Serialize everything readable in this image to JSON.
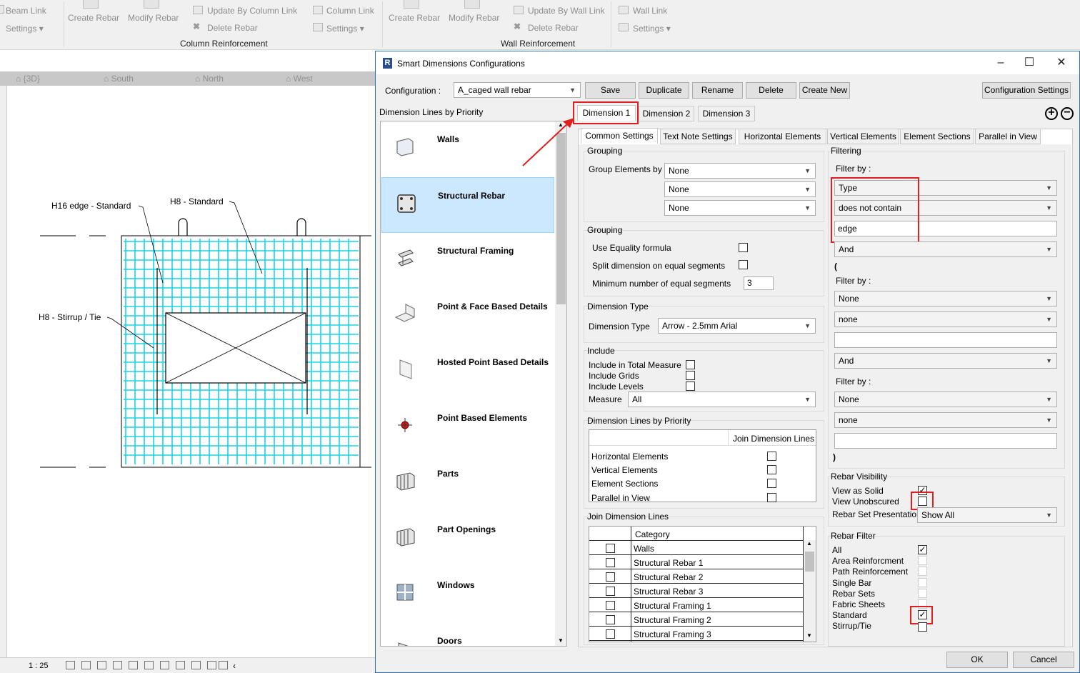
{
  "ribbon": {
    "beam_link": "Beam Link",
    "settings1": "Settings",
    "create_rebar1": "Create Rebar",
    "modify_rebar1": "Modify Rebar",
    "update_by_column_link": "Update By Column Link",
    "delete_rebar1": "Delete Rebar",
    "column_link": "Column Link",
    "settings2": "Settings",
    "column_group": "Column Reinforcement",
    "create_rebar2": "Create Rebar",
    "modify_rebar2": "Modify Rebar",
    "update_by_wall_link": "Update By Wall Link",
    "delete_rebar2": "Delete Rebar",
    "wall_link": "Wall Link",
    "settings3": "Settings",
    "wall_group": "Wall Reinforcement"
  },
  "view_tabs": [
    "{3D}",
    "South",
    "North",
    "West"
  ],
  "drawing": {
    "tag1": "H16 edge -  Standard",
    "tag2": "H8 -  Standard",
    "tag3": "H8 -  Stirrup / Tie",
    "scale": "1 : 25"
  },
  "dialog": {
    "title": "Smart Dimensions Configurations",
    "configuration_label": "Configuration :",
    "configuration_value": "A_caged wall rebar",
    "buttons": [
      "Save",
      "Duplicate",
      "Rename",
      "Delete",
      "Create New"
    ],
    "config_settings": "Configuration Settings",
    "priority_title": "Dimension Lines by Priority",
    "priority_items": [
      "Walls",
      "Structural Rebar",
      "Structural Framing",
      "Point & Face Based Details",
      "Hosted Point Based Details",
      "Point Based Elements",
      "Parts",
      "Part Openings",
      "Windows",
      "Doors"
    ],
    "dim_tabs": [
      "Dimension 1",
      "Dimension 2",
      "Dimension 3"
    ],
    "sub_tabs": [
      "Common Settings",
      "Text Note Settings",
      "Horizontal Elements",
      "Vertical Elements",
      "Element Sections",
      "Parallel in View"
    ],
    "grouping_title": "Grouping",
    "group_by_label": "Group Elements by",
    "group_values": [
      "None",
      "None",
      "None"
    ],
    "grouping2_title": "Grouping",
    "use_equality": "Use Equality formula",
    "split_dimension": "Split dimension on equal segments",
    "min_segments": "Minimum number of equal segments",
    "min_segments_value": "3",
    "dimtype_title": "Dimension Type",
    "dimtype_label": "Dimension Type",
    "dimtype_value": "Arrow - 2.5mm Arial",
    "include_title": "Include",
    "include_total": "Include in Total Measure",
    "include_grids": "Include Grids",
    "include_levels": "Include Levels",
    "measure_label": "Measure",
    "measure_value": "All",
    "dlp_title": "Dimension Lines by Priority",
    "dlp_header": "Join Dimension Lines",
    "dlp_rows": [
      "Horizontal Elements",
      "Vertical Elements",
      "Element Sections",
      "Parallel in View"
    ],
    "join_title": "Join Dimension Lines",
    "join_header": "Category",
    "join_rows": [
      "Walls",
      "Structural Rebar 1",
      "Structural Rebar 2",
      "Structural Rebar 3",
      "Structural Framing 1",
      "Structural Framing 2",
      "Structural Framing 3"
    ],
    "filtering_title": "Filtering",
    "filter_by": "Filter by :",
    "filter1": {
      "field": "Type",
      "op": "does not contain",
      "value": "edge"
    },
    "and1": "And",
    "paren_open": "(",
    "filter2": {
      "field": "None",
      "op": "none",
      "value": ""
    },
    "and2": "And",
    "filter3": {
      "field": "None",
      "op": "none",
      "value": ""
    },
    "paren_close": ")",
    "visibility_title": "Rebar Visibility",
    "view_solid": "View as Solid",
    "view_unobscured": "View Unobscured",
    "rebar_set_presentation": "Rebar Set Presentation",
    "rebar_set_value": "Show All",
    "rebar_filter_title": "Rebar Filter",
    "rebar_filters": [
      "All",
      "Area Reinforcment",
      "Path Reinforcement",
      "Single Bar",
      "Rebar Sets",
      "Fabric Sheets",
      "Standard",
      "Stirrup/Tie"
    ],
    "ok": "OK",
    "cancel": "Cancel"
  },
  "colors": {
    "rebar": "#19d3e6",
    "highlight": "#e0201f",
    "selection": "#cce8ff"
  }
}
